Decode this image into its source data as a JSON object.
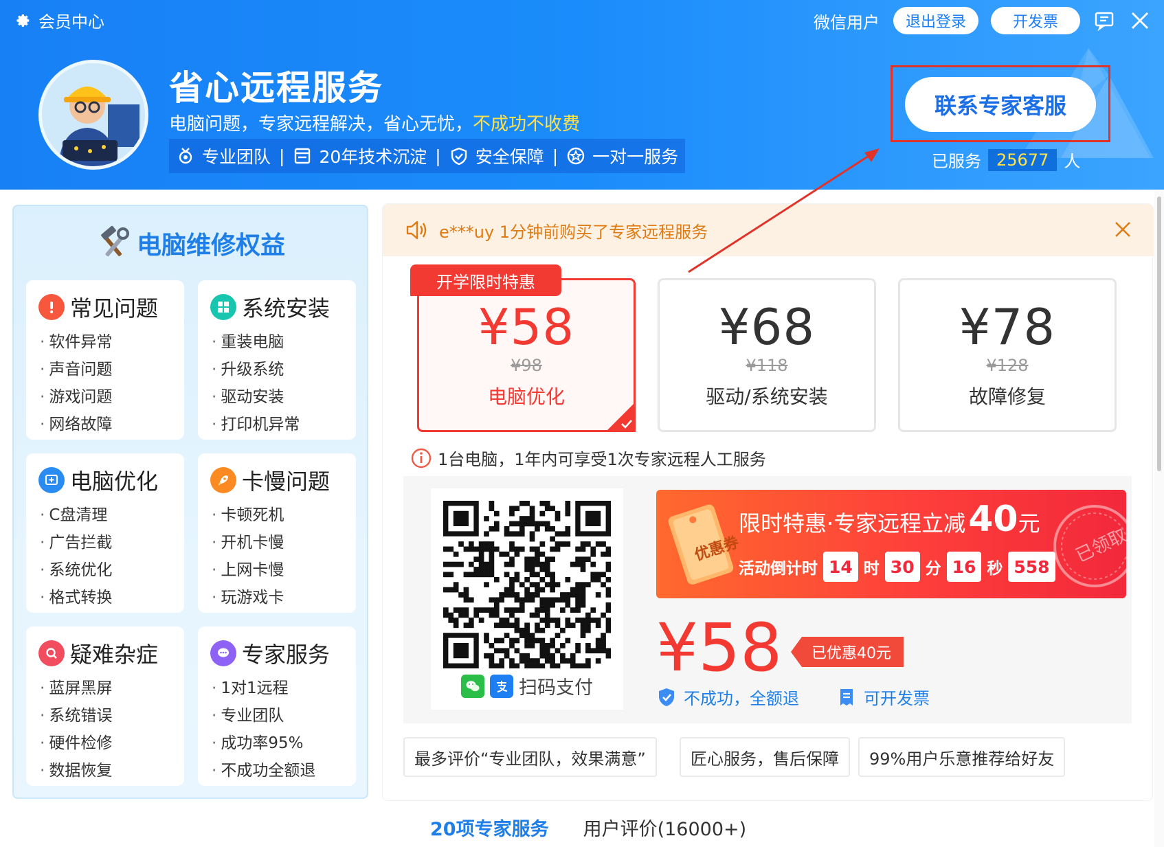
{
  "window": {
    "title": "会员中心",
    "user_name": "微信用户",
    "logout_label": "退出登录",
    "invoice_label": "开发票"
  },
  "hero": {
    "title": "省心远程服务",
    "subtitle": "电脑问题，专家远程解决，省心无忧，",
    "subtitle_highlight": "不成功不收费",
    "features": [
      "专业团队",
      "20年技术沉淀",
      "安全保障",
      "一对一服务"
    ],
    "feature_separator": "|",
    "contact_label": "联系专家客服",
    "served_prefix": "已服务",
    "served_count": "25677",
    "served_suffix": "人"
  },
  "left_panel": {
    "title": "电脑维修权益",
    "cards": [
      {
        "title": "常见问题",
        "icon": "exclamation-icon",
        "color": "#f6573d",
        "items": [
          "软件异常",
          "声音问题",
          "游戏问题",
          "网络故障"
        ]
      },
      {
        "title": "系统安装",
        "icon": "windows-icon",
        "color": "#18c6b0",
        "items": [
          "重装电脑",
          "升级系统",
          "驱动安装",
          "打印机异常"
        ]
      },
      {
        "title": "电脑优化",
        "icon": "optimize-icon",
        "color": "#2a8bf2",
        "items": [
          "C盘清理",
          "广告拦截",
          "系统优化",
          "格式转换"
        ]
      },
      {
        "title": "卡慢问题",
        "icon": "rocket-icon",
        "color": "#fb8a22",
        "items": [
          "卡顿死机",
          "开机卡慢",
          "上网卡慢",
          "玩游戏卡"
        ]
      },
      {
        "title": "疑难杂症",
        "icon": "magnifier-icon",
        "color": "#f24d5e",
        "items": [
          "蓝屏黑屏",
          "系统错误",
          "硬件检修",
          "数据恢复"
        ]
      },
      {
        "title": "专家服务",
        "icon": "chat-icon",
        "color": "#8e62f5",
        "items": [
          "1对1远程",
          "专业团队",
          "成功率95%",
          "不成功全额退"
        ]
      }
    ]
  },
  "notice": {
    "text": "e***uy 1分钟前购买了专家远程服务"
  },
  "plans": {
    "promo_tag": "开学限时特惠",
    "items": [
      {
        "price": "¥58",
        "original": "¥98",
        "name": "电脑优化",
        "selected": true
      },
      {
        "price": "¥68",
        "original": "¥118",
        "name": "驱动/系统安装",
        "selected": false
      },
      {
        "price": "¥78",
        "original": "¥128",
        "name": "故障修复",
        "selected": false
      }
    ],
    "info": "1台电脑，1年内可享受1次专家远程人工服务"
  },
  "payment": {
    "scan_label": "扫码支付",
    "banner_title": "限时特惠·专家远程立减",
    "banner_amount": "40",
    "banner_unit": "元",
    "coupon_text": "优惠券",
    "stamp_text": "已领取",
    "countdown_label": "活动倒计时",
    "countdown": {
      "hours": "14",
      "h_unit": "时",
      "minutes": "30",
      "m_unit": "分",
      "seconds": "16",
      "s_unit": "秒",
      "ms": "558"
    },
    "price": "¥58",
    "saved_label": "已优惠40元",
    "guarantee_refund": "不成功，全额退",
    "guarantee_invoice": "可开发票"
  },
  "reviews": [
    "最多评价“专业团队，效果满意”",
    "匠心服务，售后保障",
    "99%用户乐意推荐给好友"
  ],
  "tabs": [
    {
      "label": "20项专家服务",
      "active": true
    },
    {
      "label": "用户评价(16000+)",
      "active": false
    }
  ]
}
